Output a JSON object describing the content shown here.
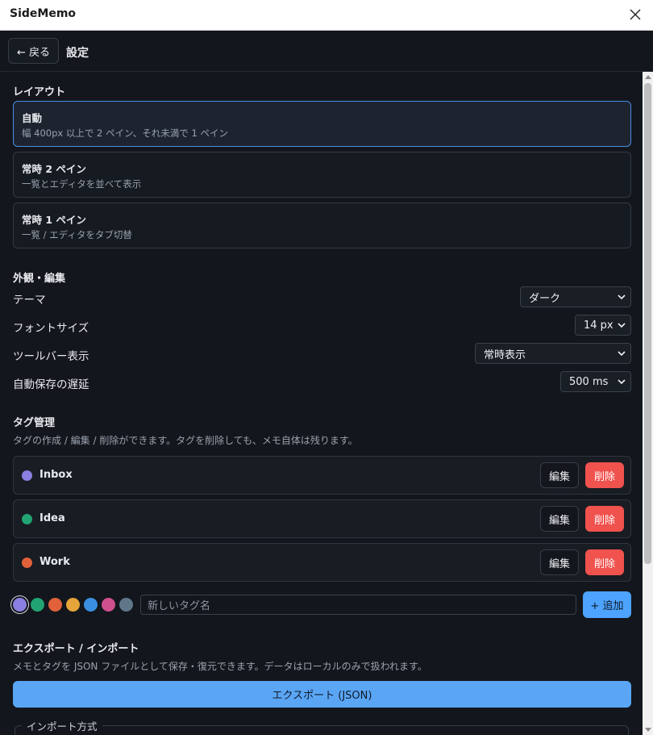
{
  "window": {
    "title": "SideMemo"
  },
  "header": {
    "back_label": "← 戻る",
    "title": "設定"
  },
  "layout_section": {
    "title": "レイアウト",
    "options": [
      {
        "title": "自動",
        "desc": "幅 400px 以上で 2 ペイン、それ未満で 1 ペイン",
        "selected": true
      },
      {
        "title": "常時 2 ペイン",
        "desc": "一覧とエディタを並べて表示",
        "selected": false
      },
      {
        "title": "常時 1 ペイン",
        "desc": "一覧 / エディタをタブ切替",
        "selected": false
      }
    ]
  },
  "appearance_section": {
    "title": "外観・編集",
    "settings": [
      {
        "label": "テーマ",
        "value": "ダーク"
      },
      {
        "label": "フォントサイズ",
        "value": "14 px"
      },
      {
        "label": "ツールバー表示",
        "value": "常時表示"
      },
      {
        "label": "自動保存の遅延",
        "value": "500 ms"
      }
    ]
  },
  "tags_section": {
    "title": "タグ管理",
    "desc": "タグの作成 / 編集 / 削除ができます。タグを削除しても、メモ自体は残ります。",
    "edit_label": "編集",
    "delete_label": "削除",
    "tags": [
      {
        "name": "Inbox",
        "color": "#8a7fe0"
      },
      {
        "name": "Idea",
        "color": "#22a372"
      },
      {
        "name": "Work",
        "color": "#e0613a"
      }
    ],
    "palette": [
      "#8a7fe0",
      "#22a372",
      "#e0613a",
      "#e5a53a",
      "#3b8fe0",
      "#d0508e",
      "#60778a"
    ],
    "new_tag_placeholder": "新しいタグ名",
    "add_label": "+ 追加"
  },
  "export_section": {
    "title": "エクスポート / インポート",
    "desc": "メモとタグを JSON ファイルとして保存・復元できます。データはローカルのみで扱われます。",
    "export_label": "エクスポート (JSON)",
    "import_mode_legend": "インポート方式"
  }
}
